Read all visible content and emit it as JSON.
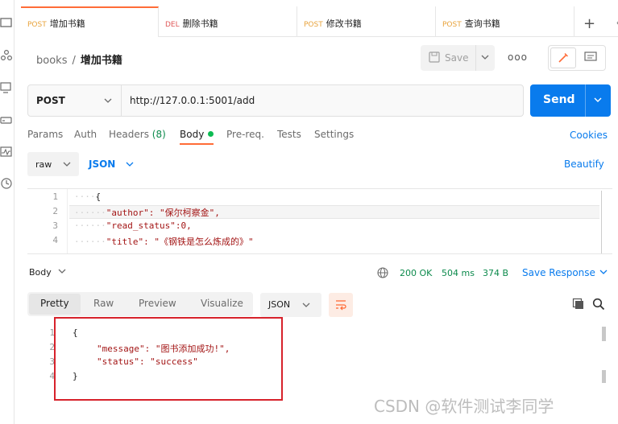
{
  "tabs": [
    {
      "method": "POST",
      "label": "增加书籍",
      "active": true
    },
    {
      "method": "DEL",
      "label": "删除书籍",
      "active": false
    },
    {
      "method": "POST",
      "label": "修改书籍",
      "active": false
    },
    {
      "method": "POST",
      "label": "查询书籍",
      "active": false
    }
  ],
  "tab_controls": {
    "add": "+",
    "more": "∘∘∘"
  },
  "breadcrumb": {
    "collection": "books",
    "separator": "/",
    "request": "增加书籍"
  },
  "toolbar": {
    "save_label": "Save",
    "more_label": "ooo"
  },
  "request": {
    "method": "POST",
    "url": "http://127.0.0.1:5001/add",
    "send_label": "Send"
  },
  "request_tabs": [
    {
      "label": "Params"
    },
    {
      "label": "Auth"
    },
    {
      "label": "Headers",
      "count": "(8)"
    },
    {
      "label": "Body",
      "active": true
    },
    {
      "label": "Pre-req."
    },
    {
      "label": "Tests"
    },
    {
      "label": "Settings"
    }
  ],
  "cookies_label": "Cookies",
  "body_options": {
    "mode": "raw",
    "format": "JSON",
    "beautify_label": "Beautify"
  },
  "request_body": {
    "line_numbers": [
      "1",
      "2",
      "3",
      "4"
    ],
    "lines": [
      "{",
      "\"author\": \"保尔柯察金\",",
      "\"read_status\":0,",
      "\"title\": \"《钢铁是怎么炼成的》\""
    ]
  },
  "response": {
    "title": "Body",
    "status": "200 OK",
    "time": "504 ms",
    "size": "374 B",
    "save_label": "Save Response",
    "view_tabs": [
      "Pretty",
      "Raw",
      "Preview",
      "Visualize"
    ],
    "format": "JSON",
    "line_numbers": [
      "1",
      "2",
      "3",
      "4"
    ],
    "lines": [
      "{",
      "\"message\": \"图书添加成功!\",",
      "\"status\": \"success\"",
      "}"
    ]
  },
  "watermark": "CSDN @软件测试李同学",
  "colors": {
    "accent": "#ff6c37",
    "primary": "#097bed",
    "highlight": "#d7222b",
    "success": "#0c8a4c"
  }
}
